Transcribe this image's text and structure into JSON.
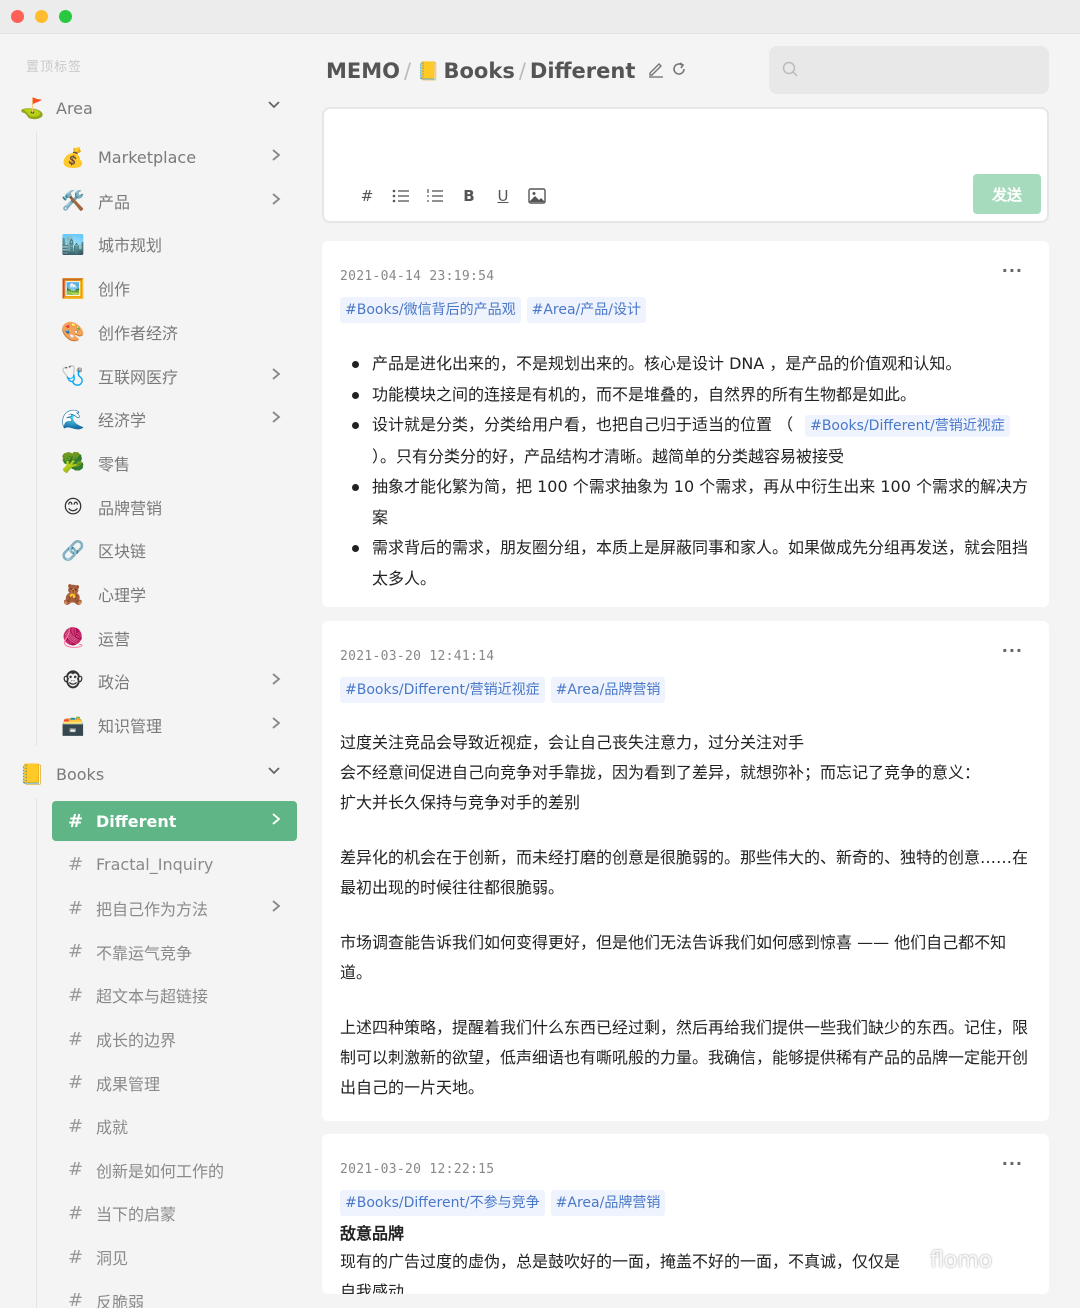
{
  "sidebar": {
    "pinned_label": "置顶标签",
    "area": {
      "title": "Area",
      "icon": "⛳",
      "items": [
        {
          "label": "Marketplace",
          "icon": "💰",
          "has_children": true
        },
        {
          "label": "产品",
          "icon": "🛠️",
          "has_children": true
        },
        {
          "label": "城市规划",
          "icon": "🏙️",
          "has_children": false
        },
        {
          "label": "创作",
          "icon": "🖼️",
          "has_children": false
        },
        {
          "label": "创作者经济",
          "icon": "🎨",
          "has_children": false
        },
        {
          "label": "互联网医疗",
          "icon": "🩺",
          "has_children": true
        },
        {
          "label": "经济学",
          "icon": "🌊",
          "has_children": true
        },
        {
          "label": "零售",
          "icon": "🥦",
          "has_children": false
        },
        {
          "label": "品牌营销",
          "icon": "😊",
          "has_children": false
        },
        {
          "label": "区块链",
          "icon": "🔗",
          "has_children": false
        },
        {
          "label": "心理学",
          "icon": "🧸",
          "has_children": false
        },
        {
          "label": "运营",
          "icon": "🧶",
          "has_children": false
        },
        {
          "label": "政治",
          "icon": "🐵",
          "has_children": true
        },
        {
          "label": "知识管理",
          "icon": "🗃️",
          "has_children": true
        }
      ]
    },
    "books": {
      "title": "Books",
      "icon": "📒",
      "items": [
        {
          "label": "Different",
          "active": true,
          "has_children": true
        },
        {
          "label": "Fractal_Inquiry",
          "has_children": false
        },
        {
          "label": "把自己作为方法",
          "has_children": true
        },
        {
          "label": "不靠运气竞争",
          "has_children": false
        },
        {
          "label": "超文本与超链接",
          "has_children": false
        },
        {
          "label": "成长的边界",
          "has_children": false
        },
        {
          "label": "成果管理",
          "has_children": false
        },
        {
          "label": "成就",
          "has_children": false
        },
        {
          "label": "创新是如何工作的",
          "has_children": false
        },
        {
          "label": "当下的启蒙",
          "has_children": false
        },
        {
          "label": "洞见",
          "has_children": false
        },
        {
          "label": "反脆弱",
          "has_children": false
        }
      ]
    }
  },
  "header": {
    "crumb1": "MEMO",
    "sep": "/",
    "book_icon": "📒",
    "crumb2": "Books",
    "crumb3": "Different"
  },
  "search": {
    "placeholder": ""
  },
  "editor": {
    "toolbar": [
      "#",
      "bullet-list-icon",
      "numbered-list-icon",
      "B",
      "U",
      "image-icon"
    ],
    "send_label": "发送"
  },
  "memos": [
    {
      "timestamp": "2021-04-14 23:19:54",
      "tags": [
        "#Books/微信背后的产品观",
        "#Area/产品/设计"
      ],
      "bullets": [
        "产品是进化出来的，不是规划出来的。核心是设计 DNA ，是产品的价值观和认知。",
        "功能模块之间的连接是有机的，而不是堆叠的，自然界的所有生物都是如此。",
        "设计就是分类，分类给用户看，也把自己归于适当的位置 （",
        "抽象才能化繁为简，把 100 个需求抽象为 10 个需求，再从中衍生出来 100 个需求的解决方案",
        "需求背后的需求，朋友圈分组，本质上是屏蔽同事和家人。如果做成先分组再发送，就会阻挡太多人。"
      ],
      "inline_tag": "#Books/Different/营销近视症",
      "bullet3_tail": "）。只有分类分的好，产品结构才清晰。越简单的分类越容易被接受"
    },
    {
      "timestamp": "2021-03-20 12:41:14",
      "tags": [
        "#Books/Different/营销近视症",
        "#Area/品牌营销"
      ],
      "paragraphs": [
        "过度关注竞品会导致近视症，会让自己丧失注意力，过分关注对手",
        "会不经意间促进自己向竞争对手靠拢，因为看到了差异，就想弥补；而忘记了竞争的意义：",
        "扩大并长久保持与竞争对手的差别",
        "差异化的机会在于创新，而未经打磨的创意是很脆弱的。那些伟大的、新奇的、独特的创意……在最初出现的时候往往都很脆弱。",
        "市场调查能告诉我们如何变得更好，但是他们无法告诉我们如何感到惊喜 —— 他们自己都不知道。",
        "上述四种策略，提醒着我们什么东西已经过剩，然后再给我们提供一些我们缺少的东西。记住，限制可以刺激新的欲望，低声细语也有嘶吼般的力量。我确信，能够提供稀有产品的品牌一定能开创出自己的一片天地。"
      ]
    },
    {
      "timestamp": "2021-03-20 12:22:15",
      "tags": [
        "#Books/Different/不参与竞争",
        "#Area/品牌营销"
      ],
      "heading": "敌意品牌",
      "paragraphs": [
        "现有的广告过度的虚伪，总是鼓吹好的一面，掩盖不好的一面，不真诚，仅仅是",
        "自我感动"
      ]
    }
  ],
  "more_label": "···",
  "watermark": "flomo"
}
